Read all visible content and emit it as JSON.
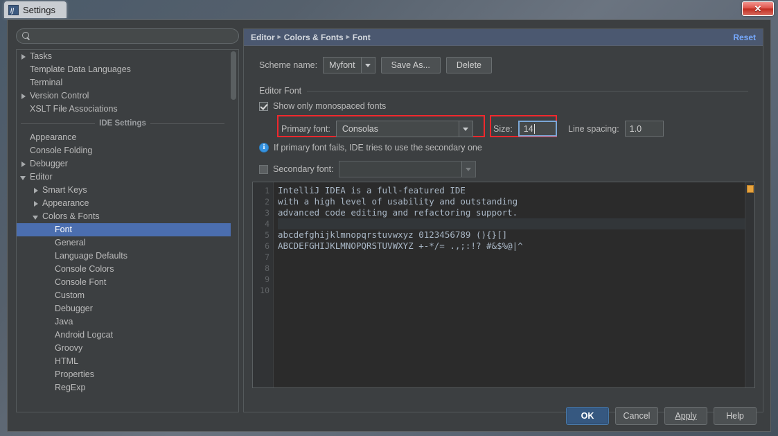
{
  "window": {
    "title": "Settings",
    "app_icon": "intellij-idea-icon",
    "close_label": "✕"
  },
  "search": {
    "placeholder": "",
    "value": "",
    "icon": "search-icon"
  },
  "sidebar": {
    "project_items": [
      {
        "label": "Tasks",
        "arrow": "closed",
        "indent": 0
      },
      {
        "label": "Template Data Languages",
        "arrow": "none",
        "indent": 0
      },
      {
        "label": "Terminal",
        "arrow": "none",
        "indent": 0
      },
      {
        "label": "Version Control",
        "arrow": "closed",
        "indent": 0
      },
      {
        "label": "XSLT File Associations",
        "arrow": "none",
        "indent": 0
      }
    ],
    "separator_label": "IDE Settings",
    "ide_items": [
      {
        "label": "Appearance",
        "arrow": "none",
        "indent": 0,
        "selected": false
      },
      {
        "label": "Console Folding",
        "arrow": "none",
        "indent": 0,
        "selected": false
      },
      {
        "label": "Debugger",
        "arrow": "closed",
        "indent": 0,
        "selected": false
      },
      {
        "label": "Editor",
        "arrow": "open",
        "indent": 0,
        "selected": false
      },
      {
        "label": "Smart Keys",
        "arrow": "closed",
        "indent": 1,
        "selected": false
      },
      {
        "label": "Appearance",
        "arrow": "closed",
        "indent": 1,
        "selected": false
      },
      {
        "label": "Colors & Fonts",
        "arrow": "open",
        "indent": 1,
        "selected": false
      },
      {
        "label": "Font",
        "arrow": "none",
        "indent": 2,
        "selected": true
      },
      {
        "label": "General",
        "arrow": "none",
        "indent": 2,
        "selected": false
      },
      {
        "label": "Language Defaults",
        "arrow": "none",
        "indent": 2,
        "selected": false
      },
      {
        "label": "Console Colors",
        "arrow": "none",
        "indent": 2,
        "selected": false
      },
      {
        "label": "Console Font",
        "arrow": "none",
        "indent": 2,
        "selected": false
      },
      {
        "label": "Custom",
        "arrow": "none",
        "indent": 2,
        "selected": false
      },
      {
        "label": "Debugger",
        "arrow": "none",
        "indent": 2,
        "selected": false
      },
      {
        "label": "Java",
        "arrow": "none",
        "indent": 2,
        "selected": false
      },
      {
        "label": "Android Logcat",
        "arrow": "none",
        "indent": 2,
        "selected": false
      },
      {
        "label": "Groovy",
        "arrow": "none",
        "indent": 2,
        "selected": false
      },
      {
        "label": "HTML",
        "arrow": "none",
        "indent": 2,
        "selected": false
      },
      {
        "label": "Properties",
        "arrow": "none",
        "indent": 2,
        "selected": false
      },
      {
        "label": "RegExp",
        "arrow": "none",
        "indent": 2,
        "selected": false
      }
    ]
  },
  "breadcrumb": {
    "parts": [
      "Editor",
      "Colors & Fonts",
      "Font"
    ],
    "separator": "▸",
    "reset_label": "Reset"
  },
  "scheme": {
    "label": "Scheme name:",
    "value": "Myfont",
    "save_as_label": "Save As...",
    "delete_label": "Delete"
  },
  "editor_font": {
    "group_title": "Editor Font",
    "monospaced_label": "Show only monospaced fonts",
    "monospaced_checked": true,
    "primary_label": "Primary font:",
    "primary_value": "Consolas",
    "size_label": "Size:",
    "size_value": "14",
    "line_spacing_label": "Line spacing:",
    "line_spacing_value": "1.0",
    "info_text": "If primary font fails, IDE tries to use the secondary one",
    "info_icon": "info-icon",
    "secondary_label": "Secondary font:",
    "secondary_value": "",
    "secondary_checked": false
  },
  "highlights": {
    "accent_color": "#f0282d",
    "focus_color": "#7ba7d7",
    "selection_color": "#4b6eaf",
    "link_color": "#77aaff",
    "marker_color": "#e8a33d"
  },
  "preview": {
    "line_numbers": [
      "1",
      "2",
      "3",
      "4",
      "5",
      "6",
      "7",
      "8",
      "9",
      "10"
    ],
    "lines": [
      "IntelliJ IDEA is a full-featured IDE",
      "with a high level of usability and outstanding",
      "advanced code editing and refactoring support.",
      "",
      "abcdefghijklmnopqrstuvwxyz 0123456789 (){}[]",
      "ABCDEFGHIJKLMNOPQRSTUVWXYZ +-*/= .,;:!? #&$%@|^",
      "",
      "",
      "",
      ""
    ]
  },
  "footer": {
    "ok_label": "OK",
    "cancel_label": "Cancel",
    "apply_label": "Apply",
    "help_label": "Help"
  }
}
